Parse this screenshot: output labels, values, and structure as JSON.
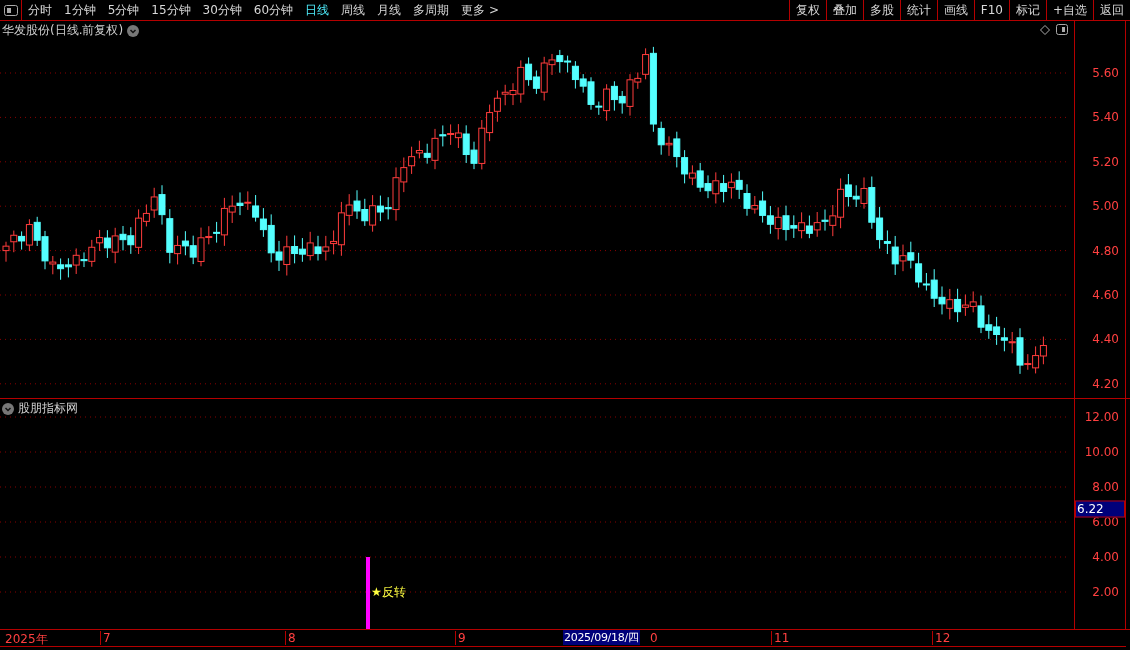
{
  "toolbar": {
    "periods": [
      {
        "label": "分时",
        "selected": false
      },
      {
        "label": "1分钟",
        "selected": false
      },
      {
        "label": "5分钟",
        "selected": false
      },
      {
        "label": "15分钟",
        "selected": false
      },
      {
        "label": "30分钟",
        "selected": false
      },
      {
        "label": "60分钟",
        "selected": false
      },
      {
        "label": "日线",
        "selected": true
      },
      {
        "label": "周线",
        "selected": false
      },
      {
        "label": "月线",
        "selected": false
      },
      {
        "label": "多周期",
        "selected": false
      },
      {
        "label": "更多 >",
        "selected": false
      }
    ],
    "actions": [
      "复权",
      "叠加",
      "多股",
      "统计",
      "画线",
      "F10",
      "标记",
      "+自选",
      "返回"
    ]
  },
  "chart": {
    "title": "华发股份(日线.前复权)",
    "price_ticks": [
      "5.60",
      "5.40",
      "5.20",
      "5.00",
      "4.80",
      "4.60",
      "4.40",
      "4.20"
    ]
  },
  "indicator": {
    "title": "股朋指标网",
    "ticks": [
      "12.00",
      "10.00",
      "8.00",
      "6.00",
      "4.00",
      "2.00"
    ],
    "cursor_value": "6.22",
    "signal": "★反转"
  },
  "time_axis": {
    "labels": [
      {
        "kind": "label",
        "text": "2025年"
      },
      {
        "kind": "label",
        "text": "7"
      },
      {
        "kind": "label",
        "text": "8"
      },
      {
        "kind": "label",
        "text": "9"
      },
      {
        "kind": "cursor",
        "text": "2025/09/18/四"
      },
      {
        "kind": "label",
        "text": "0"
      },
      {
        "kind": "label",
        "text": "11"
      },
      {
        "kind": "label",
        "text": "12"
      }
    ]
  }
}
